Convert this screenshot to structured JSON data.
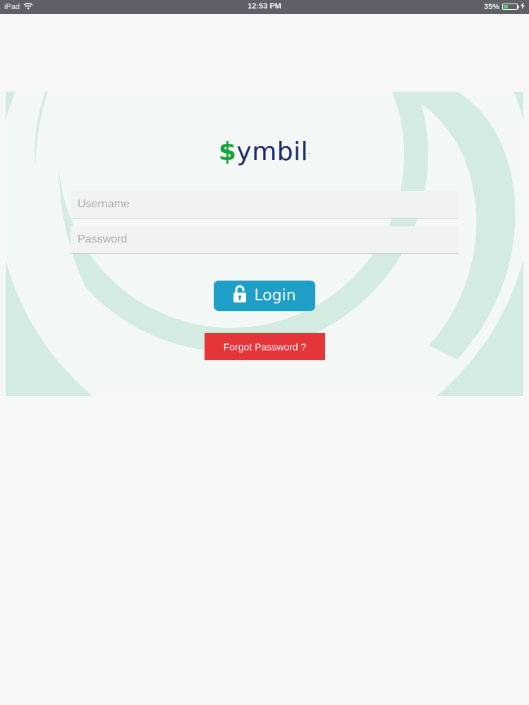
{
  "status_bar": {
    "device": "iPad",
    "time": "12:53 PM",
    "battery": "35%",
    "battery_level": 0.35,
    "icons": [
      "wifi-icon",
      "battery-icon",
      "charging-icon"
    ]
  },
  "logo": {
    "dollar": "$",
    "text": "ymbil",
    "tm": "."
  },
  "form": {
    "username_placeholder": "Username",
    "username_value": "",
    "password_placeholder": "Password",
    "password_value": "",
    "login_label": "Login",
    "login_icon": "unlock-icon",
    "forgot_label": "Forgot Password ?"
  },
  "colors": {
    "login_button": "#1f9ec7",
    "forgot_button": "#e5353a",
    "logo_dollar": "#15a33a",
    "logo_text": "#1c2a6b",
    "background_arcs": "#d3ebe0",
    "status_bar": "#5d6066"
  }
}
